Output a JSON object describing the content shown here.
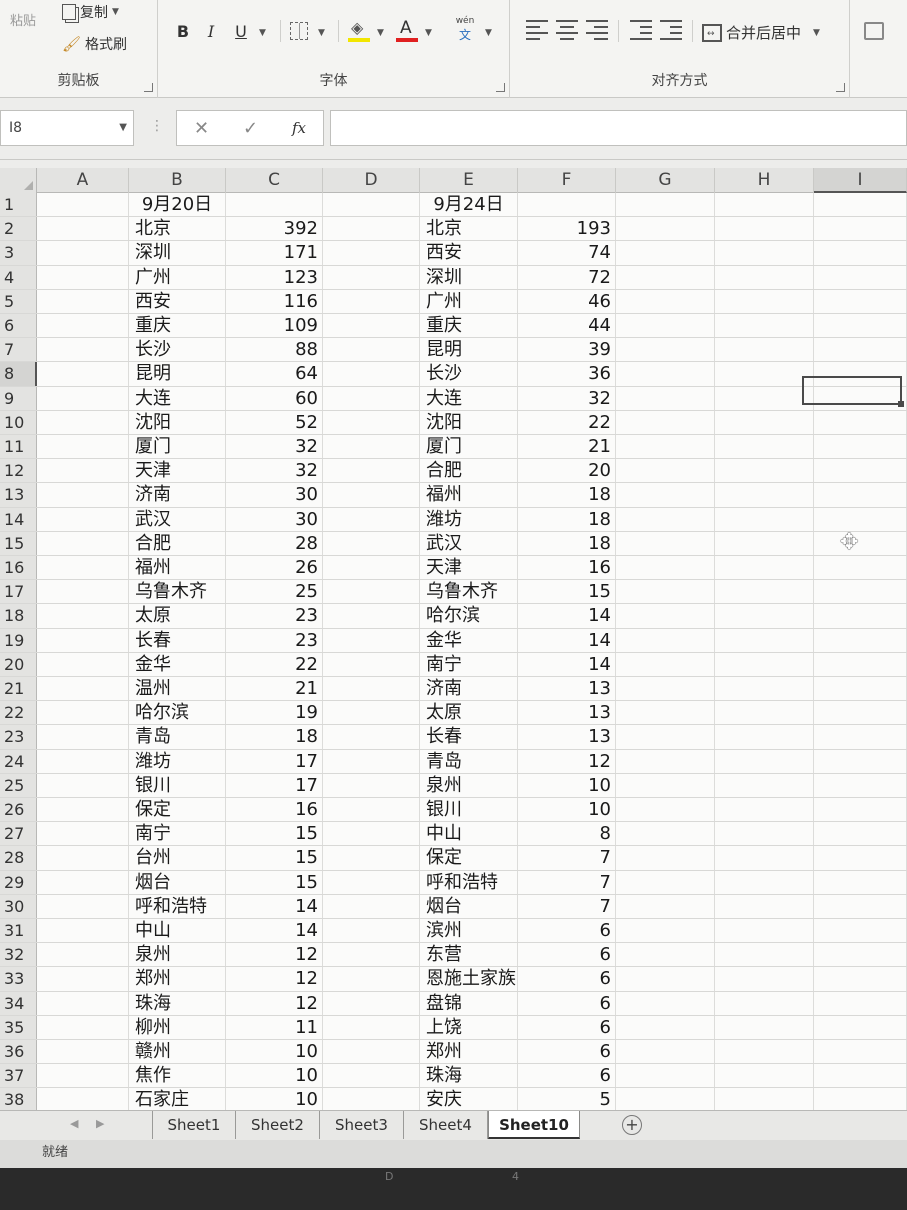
{
  "ribbon": {
    "clipboard": {
      "paste_label": "粘贴",
      "copy_label": "复制",
      "format_painter_label": "格式刷",
      "group_label": "剪贴板"
    },
    "font": {
      "bold": "B",
      "italic": "I",
      "underline": "U",
      "font_color": "A",
      "phonetic_top": "wén",
      "phonetic_bottom": "文",
      "group_label": "字体"
    },
    "alignment": {
      "merge_label": "合并后居中",
      "group_label": "对齐方式"
    }
  },
  "formula_bar": {
    "name_box": "I8",
    "cancel": "✕",
    "enter": "✓",
    "fx": "fx",
    "value": ""
  },
  "columns": [
    "A",
    "B",
    "C",
    "D",
    "E",
    "F",
    "G",
    "H",
    "I"
  ],
  "headers": {
    "b1": "9月20日",
    "e1": "9月24日"
  },
  "rows": [
    {
      "n": "1"
    },
    {
      "n": "2",
      "b": "北京",
      "c": "392",
      "e": "北京",
      "f": "193"
    },
    {
      "n": "3",
      "b": "深圳",
      "c": "171",
      "e": "西安",
      "f": "74"
    },
    {
      "n": "4",
      "b": "广州",
      "c": "123",
      "e": "深圳",
      "f": "72"
    },
    {
      "n": "5",
      "b": "西安",
      "c": "116",
      "e": "广州",
      "f": "46"
    },
    {
      "n": "6",
      "b": "重庆",
      "c": "109",
      "e": "重庆",
      "f": "44"
    },
    {
      "n": "7",
      "b": "长沙",
      "c": "88",
      "e": "昆明",
      "f": "39"
    },
    {
      "n": "8",
      "b": "昆明",
      "c": "64",
      "e": "长沙",
      "f": "36"
    },
    {
      "n": "9",
      "b": "大连",
      "c": "60",
      "e": "大连",
      "f": "32"
    },
    {
      "n": "10",
      "b": "沈阳",
      "c": "52",
      "e": "沈阳",
      "f": "22"
    },
    {
      "n": "11",
      "b": "厦门",
      "c": "32",
      "e": "厦门",
      "f": "21"
    },
    {
      "n": "12",
      "b": "天津",
      "c": "32",
      "e": "合肥",
      "f": "20"
    },
    {
      "n": "13",
      "b": "济南",
      "c": "30",
      "e": "福州",
      "f": "18"
    },
    {
      "n": "14",
      "b": "武汉",
      "c": "30",
      "e": "潍坊",
      "f": "18"
    },
    {
      "n": "15",
      "b": "合肥",
      "c": "28",
      "e": "武汉",
      "f": "18"
    },
    {
      "n": "16",
      "b": "福州",
      "c": "26",
      "e": "天津",
      "f": "16"
    },
    {
      "n": "17",
      "b": "乌鲁木齐",
      "c": "25",
      "e": "乌鲁木齐",
      "f": "15"
    },
    {
      "n": "18",
      "b": "太原",
      "c": "23",
      "e": "哈尔滨",
      "f": "14"
    },
    {
      "n": "19",
      "b": "长春",
      "c": "23",
      "e": "金华",
      "f": "14"
    },
    {
      "n": "20",
      "b": "金华",
      "c": "22",
      "e": "南宁",
      "f": "14"
    },
    {
      "n": "21",
      "b": "温州",
      "c": "21",
      "e": "济南",
      "f": "13"
    },
    {
      "n": "22",
      "b": "哈尔滨",
      "c": "19",
      "e": "太原",
      "f": "13"
    },
    {
      "n": "23",
      "b": "青岛",
      "c": "18",
      "e": "长春",
      "f": "13"
    },
    {
      "n": "24",
      "b": "潍坊",
      "c": "17",
      "e": "青岛",
      "f": "12"
    },
    {
      "n": "25",
      "b": "银川",
      "c": "17",
      "e": "泉州",
      "f": "10"
    },
    {
      "n": "26",
      "b": "保定",
      "c": "16",
      "e": "银川",
      "f": "10"
    },
    {
      "n": "27",
      "b": "南宁",
      "c": "15",
      "e": "中山",
      "f": "8"
    },
    {
      "n": "28",
      "b": "台州",
      "c": "15",
      "e": "保定",
      "f": "7"
    },
    {
      "n": "29",
      "b": "烟台",
      "c": "15",
      "e": "呼和浩特",
      "f": "7"
    },
    {
      "n": "30",
      "b": "呼和浩特",
      "c": "14",
      "e": "烟台",
      "f": "7"
    },
    {
      "n": "31",
      "b": "中山",
      "c": "14",
      "e": "滨州",
      "f": "6"
    },
    {
      "n": "32",
      "b": "泉州",
      "c": "12",
      "e": "东营",
      "f": "6"
    },
    {
      "n": "33",
      "b": "郑州",
      "c": "12",
      "e": "恩施土家族",
      "f": "6"
    },
    {
      "n": "34",
      "b": "珠海",
      "c": "12",
      "e": "盘锦",
      "f": "6"
    },
    {
      "n": "35",
      "b": "柳州",
      "c": "11",
      "e": "上饶",
      "f": "6"
    },
    {
      "n": "36",
      "b": "赣州",
      "c": "10",
      "e": "郑州",
      "f": "6"
    },
    {
      "n": "37",
      "b": "焦作",
      "c": "10",
      "e": "珠海",
      "f": "6"
    },
    {
      "n": "38",
      "b": "石家庄",
      "c": "10",
      "e": "安庆",
      "f": "5"
    }
  ],
  "sheets": [
    "Sheet1",
    "Sheet2",
    "Sheet3",
    "Sheet4",
    "Sheet10"
  ],
  "active_sheet": "Sheet10",
  "status": "就绪",
  "bottom_bezel": {
    "left": "D",
    "right": "4"
  }
}
